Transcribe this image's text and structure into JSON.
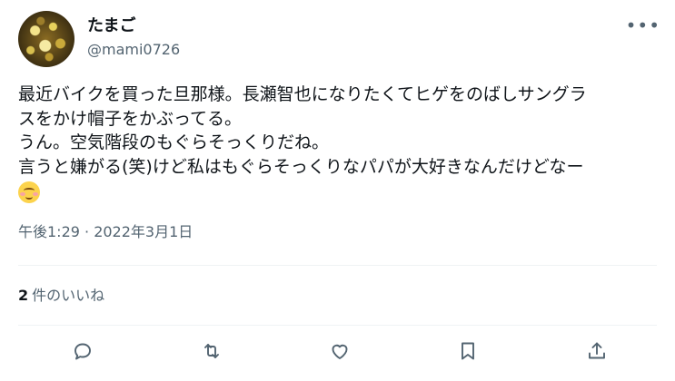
{
  "tweet": {
    "display_name": "たまご",
    "handle": "@mami0726",
    "more_label": "•••",
    "text_lines": [
      "最近バイクを買った旦那様。長瀬智也になりたくてヒゲをのばしサングラ",
      "スをかけ帽子をかぶってる。",
      "うん。空気階段のもぐらそっくりだね。",
      "言うと嫌がる(笑)けど私はもぐらそっくりなパパが大好きなんだけどなー"
    ],
    "emoji": "smiling-face-with-blush",
    "timestamp": "午後1:29 · 2022年3月1日",
    "likes_count": "2",
    "likes_label": "件のいいね"
  },
  "actions": [
    {
      "name": "reply-icon"
    },
    {
      "name": "retweet-icon"
    },
    {
      "name": "like-icon"
    },
    {
      "name": "bookmark-icon"
    },
    {
      "name": "share-icon"
    }
  ],
  "colors": {
    "secondary_text": "#536471",
    "primary_text": "#0f1419",
    "divider": "#eff3f4"
  }
}
